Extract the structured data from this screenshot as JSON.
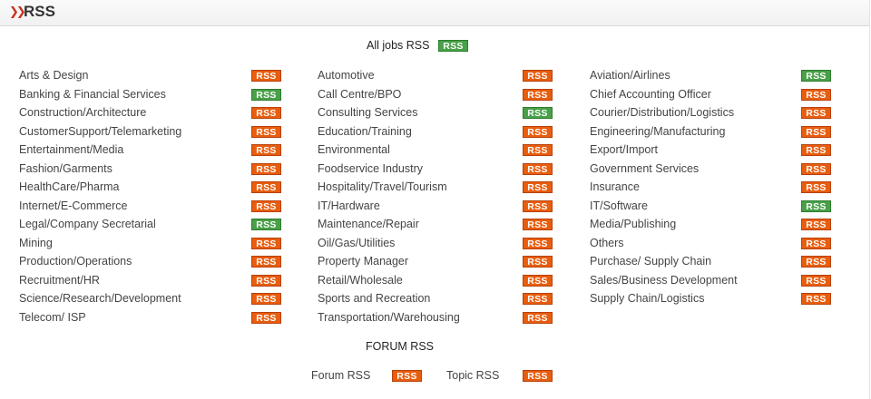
{
  "header": {
    "title": "RSS",
    "arrow_icon": "double-chevron-right-icon"
  },
  "colors": {
    "orange": "#e85d0e",
    "green": "#48a048",
    "accent": "#c8321e"
  },
  "all_jobs": {
    "label": "All jobs RSS",
    "badge": "RSS",
    "color": "green"
  },
  "columns": [
    [
      {
        "label": "Arts & Design",
        "badge": "RSS",
        "color": "orange"
      },
      {
        "label": "Banking & Financial Services",
        "badge": "RSS",
        "color": "green"
      },
      {
        "label": "Construction/Architecture",
        "badge": "RSS",
        "color": "orange"
      },
      {
        "label": "CustomerSupport/Telemarketing",
        "badge": "RSS",
        "color": "orange"
      },
      {
        "label": "Entertainment/Media",
        "badge": "RSS",
        "color": "orange"
      },
      {
        "label": "Fashion/Garments",
        "badge": "RSS",
        "color": "orange"
      },
      {
        "label": "HealthCare/Pharma",
        "badge": "RSS",
        "color": "orange"
      },
      {
        "label": "Internet/E-Commerce",
        "badge": "RSS",
        "color": "orange"
      },
      {
        "label": "Legal/Company Secretarial",
        "badge": "RSS",
        "color": "green"
      },
      {
        "label": "Mining",
        "badge": "RSS",
        "color": "orange"
      },
      {
        "label": "Production/Operations",
        "badge": "RSS",
        "color": "orange"
      },
      {
        "label": "Recruitment/HR",
        "badge": "RSS",
        "color": "orange"
      },
      {
        "label": "Science/Research/Development",
        "badge": "RSS",
        "color": "orange"
      },
      {
        "label": "Telecom/ ISP",
        "badge": "RSS",
        "color": "orange"
      }
    ],
    [
      {
        "label": "Automotive",
        "badge": "RSS",
        "color": "orange"
      },
      {
        "label": "Call Centre/BPO",
        "badge": "RSS",
        "color": "orange"
      },
      {
        "label": "Consulting Services",
        "badge": "RSS",
        "color": "green"
      },
      {
        "label": "Education/Training",
        "badge": "RSS",
        "color": "orange"
      },
      {
        "label": "Environmental",
        "badge": "RSS",
        "color": "orange"
      },
      {
        "label": "Foodservice Industry",
        "badge": "RSS",
        "color": "orange"
      },
      {
        "label": "Hospitality/Travel/Tourism",
        "badge": "RSS",
        "color": "orange"
      },
      {
        "label": "IT/Hardware",
        "badge": "RSS",
        "color": "orange"
      },
      {
        "label": "Maintenance/Repair",
        "badge": "RSS",
        "color": "orange"
      },
      {
        "label": "Oil/Gas/Utilities",
        "badge": "RSS",
        "color": "orange"
      },
      {
        "label": "Property Manager",
        "badge": "RSS",
        "color": "orange"
      },
      {
        "label": "Retail/Wholesale",
        "badge": "RSS",
        "color": "orange"
      },
      {
        "label": "Sports and Recreation",
        "badge": "RSS",
        "color": "orange"
      },
      {
        "label": "Transportation/Warehousing",
        "badge": "RSS",
        "color": "orange"
      }
    ],
    [
      {
        "label": "Aviation/Airlines",
        "badge": "RSS",
        "color": "green"
      },
      {
        "label": "Chief Accounting Officer",
        "badge": "RSS",
        "color": "orange"
      },
      {
        "label": "Courier/Distribution/Logistics",
        "badge": "RSS",
        "color": "orange"
      },
      {
        "label": "Engineering/Manufacturing",
        "badge": "RSS",
        "color": "orange"
      },
      {
        "label": "Export/Import",
        "badge": "RSS",
        "color": "orange"
      },
      {
        "label": "Government Services",
        "badge": "RSS",
        "color": "orange"
      },
      {
        "label": "Insurance",
        "badge": "RSS",
        "color": "orange"
      },
      {
        "label": "IT/Software",
        "badge": "RSS",
        "color": "green"
      },
      {
        "label": "Media/Publishing",
        "badge": "RSS",
        "color": "orange"
      },
      {
        "label": "Others",
        "badge": "RSS",
        "color": "orange"
      },
      {
        "label": "Purchase/ Supply Chain",
        "badge": "RSS",
        "color": "orange"
      },
      {
        "label": "Sales/Business Development",
        "badge": "RSS",
        "color": "orange"
      },
      {
        "label": "Supply Chain/Logistics",
        "badge": "RSS",
        "color": "orange"
      }
    ]
  ],
  "forum": {
    "title": "FORUM RSS",
    "forum_label": "Forum RSS",
    "forum_badge": "RSS",
    "topic_label": "Topic RSS",
    "topic_badge": "RSS"
  }
}
